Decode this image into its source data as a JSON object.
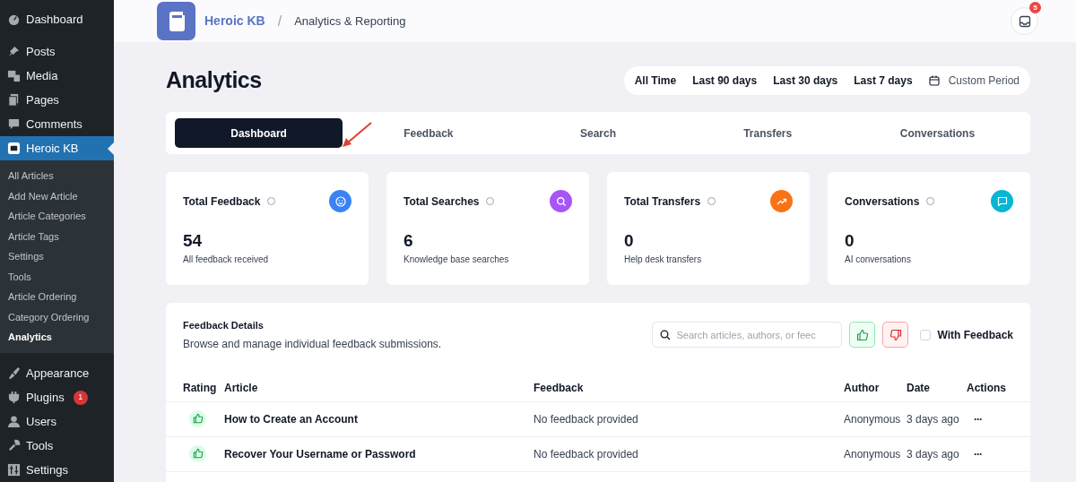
{
  "sidebar": {
    "items": [
      {
        "label": "Dashboard",
        "selected": false
      },
      {
        "label": "Posts",
        "selected": false
      },
      {
        "label": "Media",
        "selected": false
      },
      {
        "label": "Pages",
        "selected": false
      },
      {
        "label": "Comments",
        "selected": false
      },
      {
        "label": "Heroic KB",
        "selected": true,
        "children": [
          {
            "label": "All Articles",
            "selected": false
          },
          {
            "label": "Add New Article",
            "selected": false
          },
          {
            "label": "Article Categories",
            "selected": false
          },
          {
            "label": "Article Tags",
            "selected": false
          },
          {
            "label": "Settings",
            "selected": false
          },
          {
            "label": "Tools",
            "selected": false
          },
          {
            "label": "Article Ordering",
            "selected": false
          },
          {
            "label": "Category Ordering",
            "selected": false
          },
          {
            "label": "Analytics",
            "selected": true
          }
        ]
      },
      {
        "label": "Appearance",
        "selected": false
      },
      {
        "label": "Plugins",
        "selected": false,
        "badge": "1"
      },
      {
        "label": "Users",
        "selected": false
      },
      {
        "label": "Tools",
        "selected": false
      },
      {
        "label": "Settings",
        "selected": false
      }
    ]
  },
  "header": {
    "brand": "Heroic KB",
    "separator": "/",
    "breadcrumb": "Analytics & Reporting",
    "notification_count": "5"
  },
  "page_title": "Analytics",
  "periods": [
    {
      "label": "All Time",
      "kind": "preset"
    },
    {
      "label": "Last 90 days",
      "kind": "preset"
    },
    {
      "label": "Last 30 days",
      "kind": "preset"
    },
    {
      "label": "Last 7 days",
      "kind": "preset"
    },
    {
      "label": "Custom Period",
      "kind": "custom"
    }
  ],
  "tabs": [
    {
      "label": "Dashboard",
      "selected": true
    },
    {
      "label": "Feedback",
      "selected": false
    },
    {
      "label": "Search",
      "selected": false
    },
    {
      "label": "Transfers",
      "selected": false
    },
    {
      "label": "Conversations",
      "selected": false
    }
  ],
  "stats": [
    {
      "title": "Total Feedback",
      "value": "54",
      "caption": "All feedback received",
      "color": "#3b82f6"
    },
    {
      "title": "Total Searches",
      "value": "6",
      "caption": "Knowledge base searches",
      "color": "#a855f7"
    },
    {
      "title": "Total Transfers",
      "value": "0",
      "caption": "Help desk transfers",
      "color": "#f97316"
    },
    {
      "title": "Conversations",
      "value": "0",
      "caption": "AI conversations",
      "color": "#06b6d4"
    }
  ],
  "feedback": {
    "title": "Feedback Details",
    "subtitle": "Browse and manage individual feedback submissions.",
    "search": {
      "placeholder": "Search articles, authors, or feec"
    },
    "with_feedback": {
      "label": "With Feedback",
      "checked": false
    },
    "columns": [
      "Rating",
      "Article",
      "Feedback",
      "Author",
      "Date",
      "Actions"
    ],
    "rows": [
      {
        "positive": true,
        "article": "How to Create an Account",
        "feedback": "No feedback provided",
        "author": "Anonymous",
        "date": "3 days ago",
        "actions": "···"
      },
      {
        "positive": true,
        "article": "Recover Your Username or Password",
        "feedback": "No feedback provided",
        "author": "Anonymous",
        "date": "3 days ago",
        "actions": "···"
      }
    ]
  }
}
